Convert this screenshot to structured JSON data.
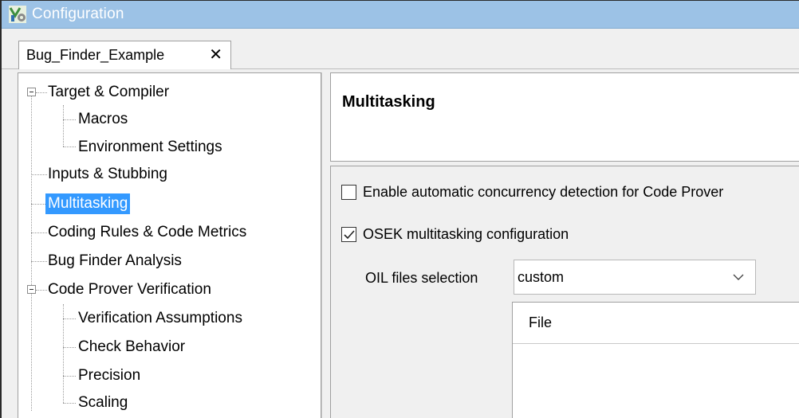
{
  "window": {
    "title": "Configuration",
    "icon": "configuration-app-icon"
  },
  "tabs": [
    {
      "label": "Bug_Finder_Example",
      "close_glyph": "✕"
    }
  ],
  "tree": {
    "items": [
      {
        "label": "Target & Compiler",
        "expandable": true,
        "expanded": true
      },
      {
        "label": "Macros"
      },
      {
        "label": "Environment Settings"
      },
      {
        "label": "Inputs & Stubbing"
      },
      {
        "label": "Multitasking",
        "selected": true
      },
      {
        "label": "Coding Rules & Code Metrics"
      },
      {
        "label": "Bug Finder Analysis"
      },
      {
        "label": "Code Prover Verification",
        "expandable": true,
        "expanded": true
      },
      {
        "label": "Verification Assumptions"
      },
      {
        "label": "Check Behavior"
      },
      {
        "label": "Precision"
      },
      {
        "label": "Scaling"
      }
    ]
  },
  "panel": {
    "title": "Multitasking",
    "options": {
      "auto_concurrency": {
        "label": "Enable automatic concurrency detection for Code Prover",
        "checked": false
      },
      "osek": {
        "label": "OSEK multitasking configuration",
        "checked": true
      }
    },
    "oil_files": {
      "label": "OIL files selection",
      "selected": "custom"
    },
    "file_table": {
      "columns": [
        "File"
      ],
      "rows": []
    }
  },
  "colors": {
    "titlebar": "#9cc2e6",
    "selection": "#3399ff"
  }
}
